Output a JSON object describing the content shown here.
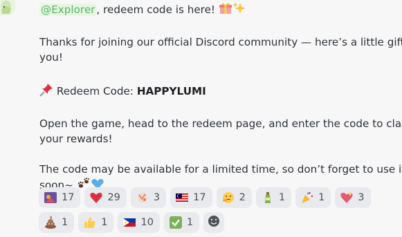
{
  "message": {
    "mention": "@Explorer",
    "intro_suffix": ", redeem code is here!",
    "thanks_line1": "Thanks for joining our official Discord community — here’s a little gift for",
    "thanks_line2": "you!",
    "redeem_label": "Redeem Code:",
    "redeem_code": "HAPPYLUMI",
    "open_line1": "Open the game, head to the redeem page, and enter the code to claim",
    "open_line2": "your rewards!",
    "limited_line1": "The code may be available for a limited time, so don’t forget to use it",
    "limited_line2": "soon~"
  },
  "reactions": [
    {
      "icon": "custom-emote-icon",
      "count": "17"
    },
    {
      "icon": "red-heart-icon",
      "count": "29"
    },
    {
      "icon": "custom-sticker-icon",
      "count": "3"
    },
    {
      "icon": "malaysia-flag-icon",
      "count": "17"
    },
    {
      "icon": "face-with-hand-icon",
      "count": "2"
    },
    {
      "icon": "bottle-icon",
      "count": "1"
    },
    {
      "icon": "party-popper-icon",
      "count": "1"
    },
    {
      "icon": "sparkling-heart-icon",
      "count": "3"
    },
    {
      "icon": "pile-of-poo-icon",
      "count": "1"
    },
    {
      "icon": "thumbs-up-icon",
      "count": "1"
    },
    {
      "icon": "philippines-flag-icon",
      "count": "10"
    },
    {
      "icon": "check-mark-button-icon",
      "count": "1"
    }
  ]
}
